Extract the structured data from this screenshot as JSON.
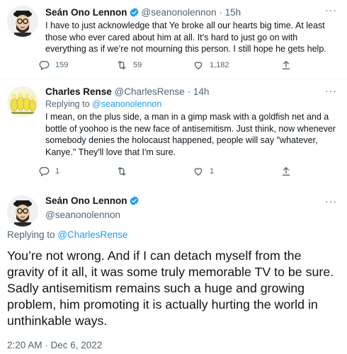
{
  "tweets": [
    {
      "name": "Seán Ono Lennon",
      "handle": "@seanonolennon",
      "separator": "·",
      "time": "15h",
      "text": "I have to just acknowledge that Ye broke all our hearts big time. At least those who ever cared about him at all. It’s hard to just go on with everything as if we’re not mourning this person. I still hope he gets help.",
      "replies": "159",
      "retweets": "59",
      "likes": "1,182"
    },
    {
      "name": "Charles Rense",
      "handle": "@CharlesRense",
      "separator": "·",
      "time": "14h",
      "replying_prefix": "Replying to ",
      "replying_to": "@seanonolennon",
      "text": "I mean, on the plus side, a man in a gimp mask with a goldfish net and a bottle of yoohoo is the new face of antisemitism. Just think, now whenever somebody denies the holocaust happened, people will say \"whatever, Kanye.\" They'll love that I'm sure.",
      "replies": "1",
      "retweets": "",
      "likes": "1"
    }
  ],
  "main_tweet": {
    "name": "Seán Ono Lennon",
    "handle": "@seanonolennon",
    "replying_prefix": "Replying to ",
    "replying_to": "@CharlesRense",
    "text": "You’re not wrong. And if I can detach myself from the gravity of it all, it was some truly memorable TV to be sure. Sadly antisemitism remains such a huge and growing problem, him promoting it is actually hurting the world in unthinkable ways.",
    "timestamp": "2:20 AM · Dec 6, 2022"
  },
  "icons": {
    "verified": "verified-badge-icon",
    "reply": "reply-icon",
    "retweet": "retweet-icon",
    "like": "heart-icon",
    "share": "share-icon",
    "more": "more-icon"
  },
  "colors": {
    "accent": "#1d9bf0",
    "secondary_text": "#536471",
    "primary_text": "#0f1419"
  }
}
